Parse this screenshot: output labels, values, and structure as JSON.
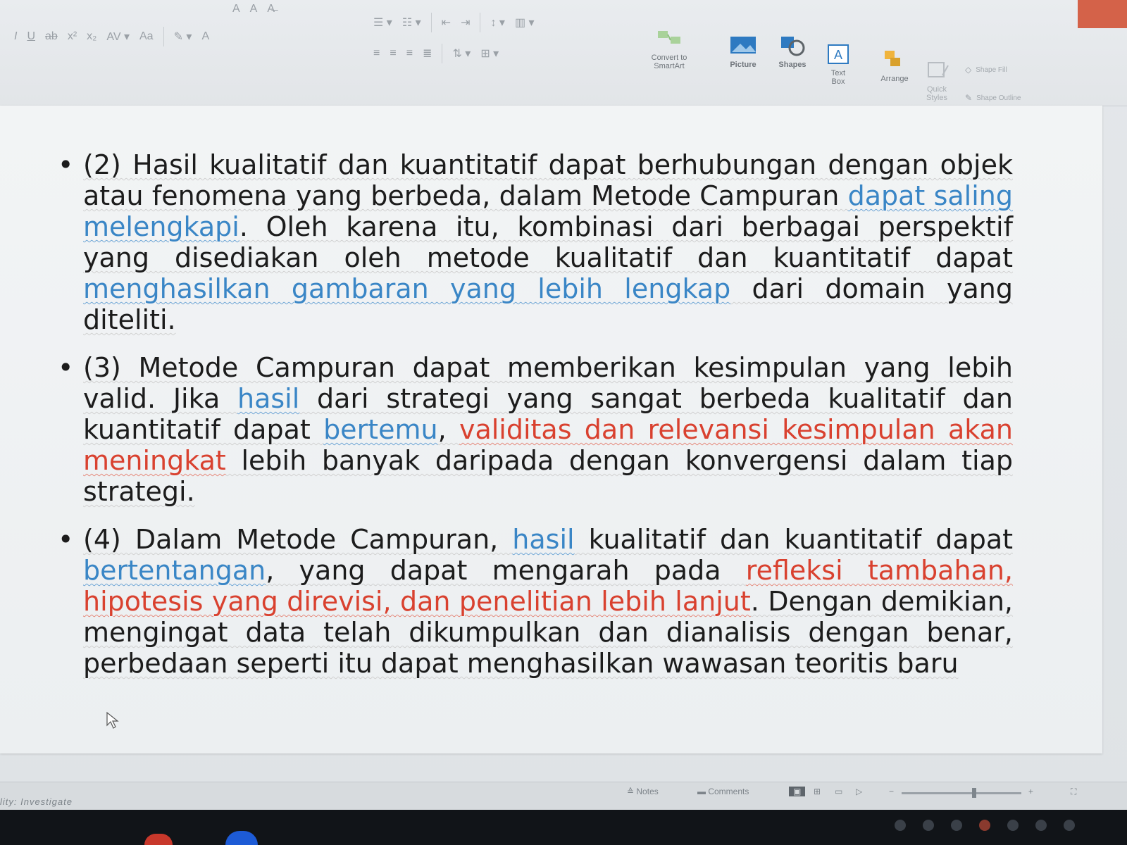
{
  "ribbon": {
    "font_tools": [
      "A",
      "A",
      "Aa"
    ],
    "convert_smartart": "Convert to SmartArt",
    "picture": "Picture",
    "shapes": "Shapes",
    "text_box": "Text Box",
    "arrange": "Arrange",
    "quick_styles": "Quick Styles",
    "shape_fill": "Shape Fill",
    "shape_outline": "Shape Outline"
  },
  "slide": {
    "bullets": [
      {
        "segments": [
          {
            "text": "(2) Hasil kualitatif dan kuantitatif dapat berhubungan dengan objek atau fenomena yang berbeda, dalam Metode Campuran ",
            "color": "black"
          },
          {
            "text": "dapat saling melengkapi",
            "color": "blue"
          },
          {
            "text": ". Oleh karena itu, kombinasi dari berbagai perspektif yang disediakan oleh metode kualitatif dan kuantitatif dapat ",
            "color": "black"
          },
          {
            "text": "menghasilkan gambaran yang lebih lengkap",
            "color": "blue"
          },
          {
            "text": " dari domain yang diteliti.",
            "color": "black"
          }
        ]
      },
      {
        "segments": [
          {
            "text": "(3) Metode Campuran dapat memberikan kesimpulan yang lebih valid. Jika ",
            "color": "black"
          },
          {
            "text": "hasil",
            "color": "blue"
          },
          {
            "text": " dari strategi yang sangat berbeda kualitatif dan kuantitatif dapat ",
            "color": "black"
          },
          {
            "text": "bertemu",
            "color": "blue"
          },
          {
            "text": ", ",
            "color": "black"
          },
          {
            "text": "validitas dan relevansi kesimpulan akan meningkat",
            "color": "red"
          },
          {
            "text": " lebih banyak daripada dengan konvergensi dalam tiap strategi.",
            "color": "black"
          }
        ]
      },
      {
        "segments": [
          {
            "text": "(4) Dalam Metode Campuran, ",
            "color": "black"
          },
          {
            "text": "hasil",
            "color": "blue"
          },
          {
            "text": " kualitatif dan kuantitatif dapat ",
            "color": "black"
          },
          {
            "text": "bertentangan",
            "color": "blue"
          },
          {
            "text": ", yang dapat mengarah pada ",
            "color": "black"
          },
          {
            "text": "refleksi tambahan, hipotesis yang direvisi, dan penelitian lebih lanjut",
            "color": "red"
          },
          {
            "text": ". Dengan demikian, mengingat data telah dikumpulkan dan dianalisis dengan benar, perbedaan seperti itu dapat menghasilkan wawasan teoritis baru",
            "color": "black"
          }
        ]
      }
    ]
  },
  "statusbar": {
    "accessibility": "lity: Investigate",
    "notes": "Notes",
    "comments": "Comments"
  },
  "colors": {
    "text": "#1c1c1c",
    "blue": "#3a86c6",
    "red": "#d9412f",
    "accent": "#d04a2c"
  }
}
